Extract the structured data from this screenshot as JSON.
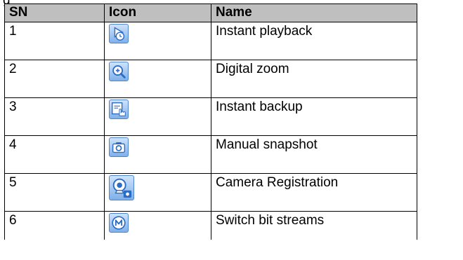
{
  "caption_fragment": "g",
  "headers": {
    "sn": "SN",
    "icon": "Icon",
    "name": "Name"
  },
  "rows": [
    {
      "sn": "1",
      "icon": "instant-playback-icon",
      "name": "Instant playback"
    },
    {
      "sn": "2",
      "icon": "digital-zoom-icon",
      "name": "Digital zoom"
    },
    {
      "sn": "3",
      "icon": "instant-backup-icon",
      "name": "Instant backup"
    },
    {
      "sn": "4",
      "icon": "manual-snapshot-icon",
      "name": "Manual snapshot"
    },
    {
      "sn": "5",
      "icon": "camera-registration-icon",
      "name": "Camera Registration"
    },
    {
      "sn": "6",
      "icon": "switch-bit-streams-icon",
      "name": "Switch bit streams"
    }
  ],
  "colors": {
    "header_background": "#bfbfbf",
    "icon_blue": "#2b6cc4",
    "icon_light": "#cfe3fb"
  }
}
